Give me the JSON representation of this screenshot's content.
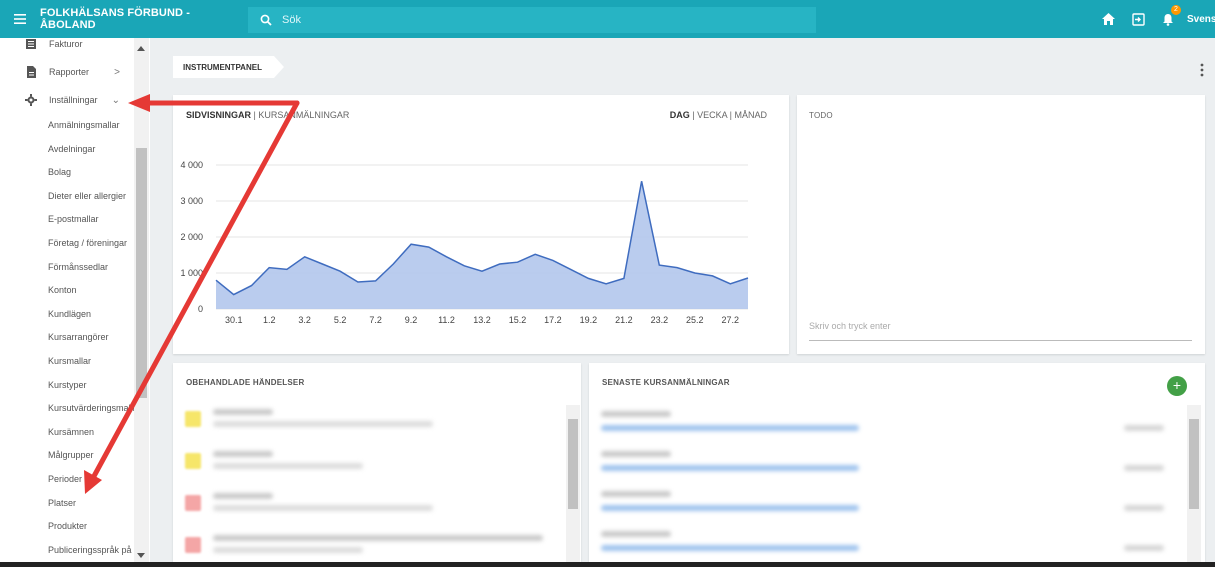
{
  "topbar": {
    "title": "FOLKHÄLSANS FÖRBUND - ÅBOLAND",
    "search_placeholder": "Sök",
    "notification_count": "2",
    "language": "Svenska"
  },
  "sidebar": {
    "items": [
      {
        "label": "Fakturor"
      },
      {
        "label": "Rapporter",
        "chevron": ">"
      },
      {
        "label": "Inställningar",
        "chevron": "⌄"
      }
    ],
    "sub_items": [
      "Anmälningsmallar",
      "Avdelningar",
      "Bolag",
      "Dieter eller allergier",
      "E-postmallar",
      "Företag / föreningar",
      "Förmånssedlar",
      "Konton",
      "Kundlägen",
      "Kursarrangörer",
      "Kursmallar",
      "Kurstyper",
      "Kursutvärderingsmallar",
      "Kursämnen",
      "Målgrupper",
      "Perioder",
      "Platser",
      "Produkter",
      "Publiceringsspråk på webben"
    ]
  },
  "breadcrumb": "INSTRUMENTPANEL",
  "chart_card": {
    "tab_active": "SIDVISNINGAR",
    "tab_inactive": "KURSANMÄLNINGAR",
    "sep": " | ",
    "period_active": "DAG",
    "period_2": "VECKA",
    "period_3": "MÅNAD"
  },
  "todo_card": {
    "title": "TODO",
    "input_placeholder": "Skriv och tryck enter"
  },
  "events_card": {
    "title": "OBEHANDLADE HÄNDELSER"
  },
  "registrations_card": {
    "title": "SENASTE KURSANMÄLNINGAR",
    "add_label": "+"
  },
  "colors": {
    "topbar": "#1aa6b7",
    "chart_line": "#3f6cbf",
    "chart_fill": "#b3c6ec",
    "annotation_arrow": "#e53935",
    "fab": "#43a047"
  },
  "chart_data": {
    "type": "area",
    "y_ticks": [
      "0",
      "1 000",
      "2 000",
      "3 000",
      "4 000"
    ],
    "ylim": [
      0,
      4000
    ],
    "x_tick_labels": [
      "30.1",
      "1.2",
      "3.2",
      "5.2",
      "7.2",
      "9.2",
      "11.2",
      "13.2",
      "15.2",
      "17.2",
      "19.2",
      "21.2",
      "23.2",
      "25.2",
      "27.2"
    ],
    "values": [
      800,
      400,
      650,
      1150,
      1100,
      1450,
      1250,
      1050,
      750,
      780,
      1250,
      1800,
      1720,
      1450,
      1200,
      1050,
      1250,
      1300,
      1520,
      1350,
      1100,
      850,
      700,
      850,
      3550,
      1220,
      1150,
      1000,
      920,
      700,
      860
    ],
    "grid": true
  }
}
